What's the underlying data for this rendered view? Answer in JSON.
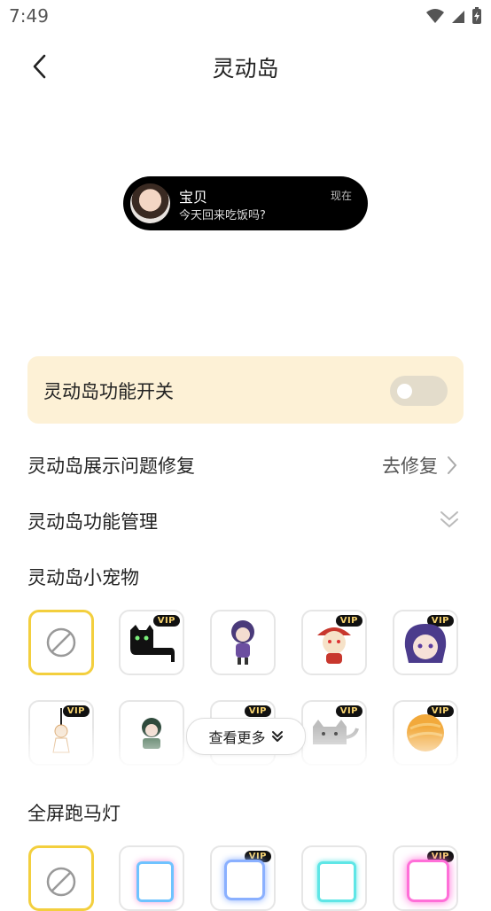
{
  "status_bar": {
    "time": "7:49"
  },
  "header": {
    "title": "灵动岛"
  },
  "island_preview": {
    "name": "宝贝",
    "message": "今天回来吃饭吗?",
    "time": "现在"
  },
  "toggle": {
    "label": "灵动岛功能开关",
    "enabled": false
  },
  "repair_row": {
    "label": "灵动岛展示问题修复",
    "action": "去修复"
  },
  "manage_row": {
    "label": "灵动岛功能管理"
  },
  "pets_section": {
    "title": "灵动岛小宠物",
    "row1": [
      {
        "kind": "none",
        "vip": false
      },
      {
        "kind": "black-cat",
        "vip": true
      },
      {
        "kind": "purple-hair-chibi",
        "vip": false
      },
      {
        "kind": "red-hat-chibi",
        "vip": true
      },
      {
        "kind": "purple-hair-face",
        "vip": true
      }
    ],
    "row2": [
      {
        "kind": "hanging-figure",
        "vip": true
      },
      {
        "kind": "green-hair-chibi",
        "vip": false
      },
      {
        "kind": "hidden",
        "vip": true
      },
      {
        "kind": "gray-cat",
        "vip": true
      },
      {
        "kind": "orange-ball",
        "vip": true
      }
    ],
    "vip_label": "VIP",
    "see_more": "查看更多"
  },
  "marquee_section": {
    "title": "全屏跑马灯",
    "items": [
      {
        "kind": "none",
        "vip": false
      },
      {
        "kind": "blue-pink-frame",
        "vip": false
      },
      {
        "kind": "blue-neon-frame",
        "vip": true
      },
      {
        "kind": "cyan-frame",
        "vip": false
      },
      {
        "kind": "pink-glow-frame",
        "vip": true
      }
    ]
  },
  "colors": {
    "accent_yellow": "#f3cf3e",
    "card_bg": "#fdf1d6",
    "island_bg": "#000000",
    "vip_gold": "#f6d26e"
  }
}
